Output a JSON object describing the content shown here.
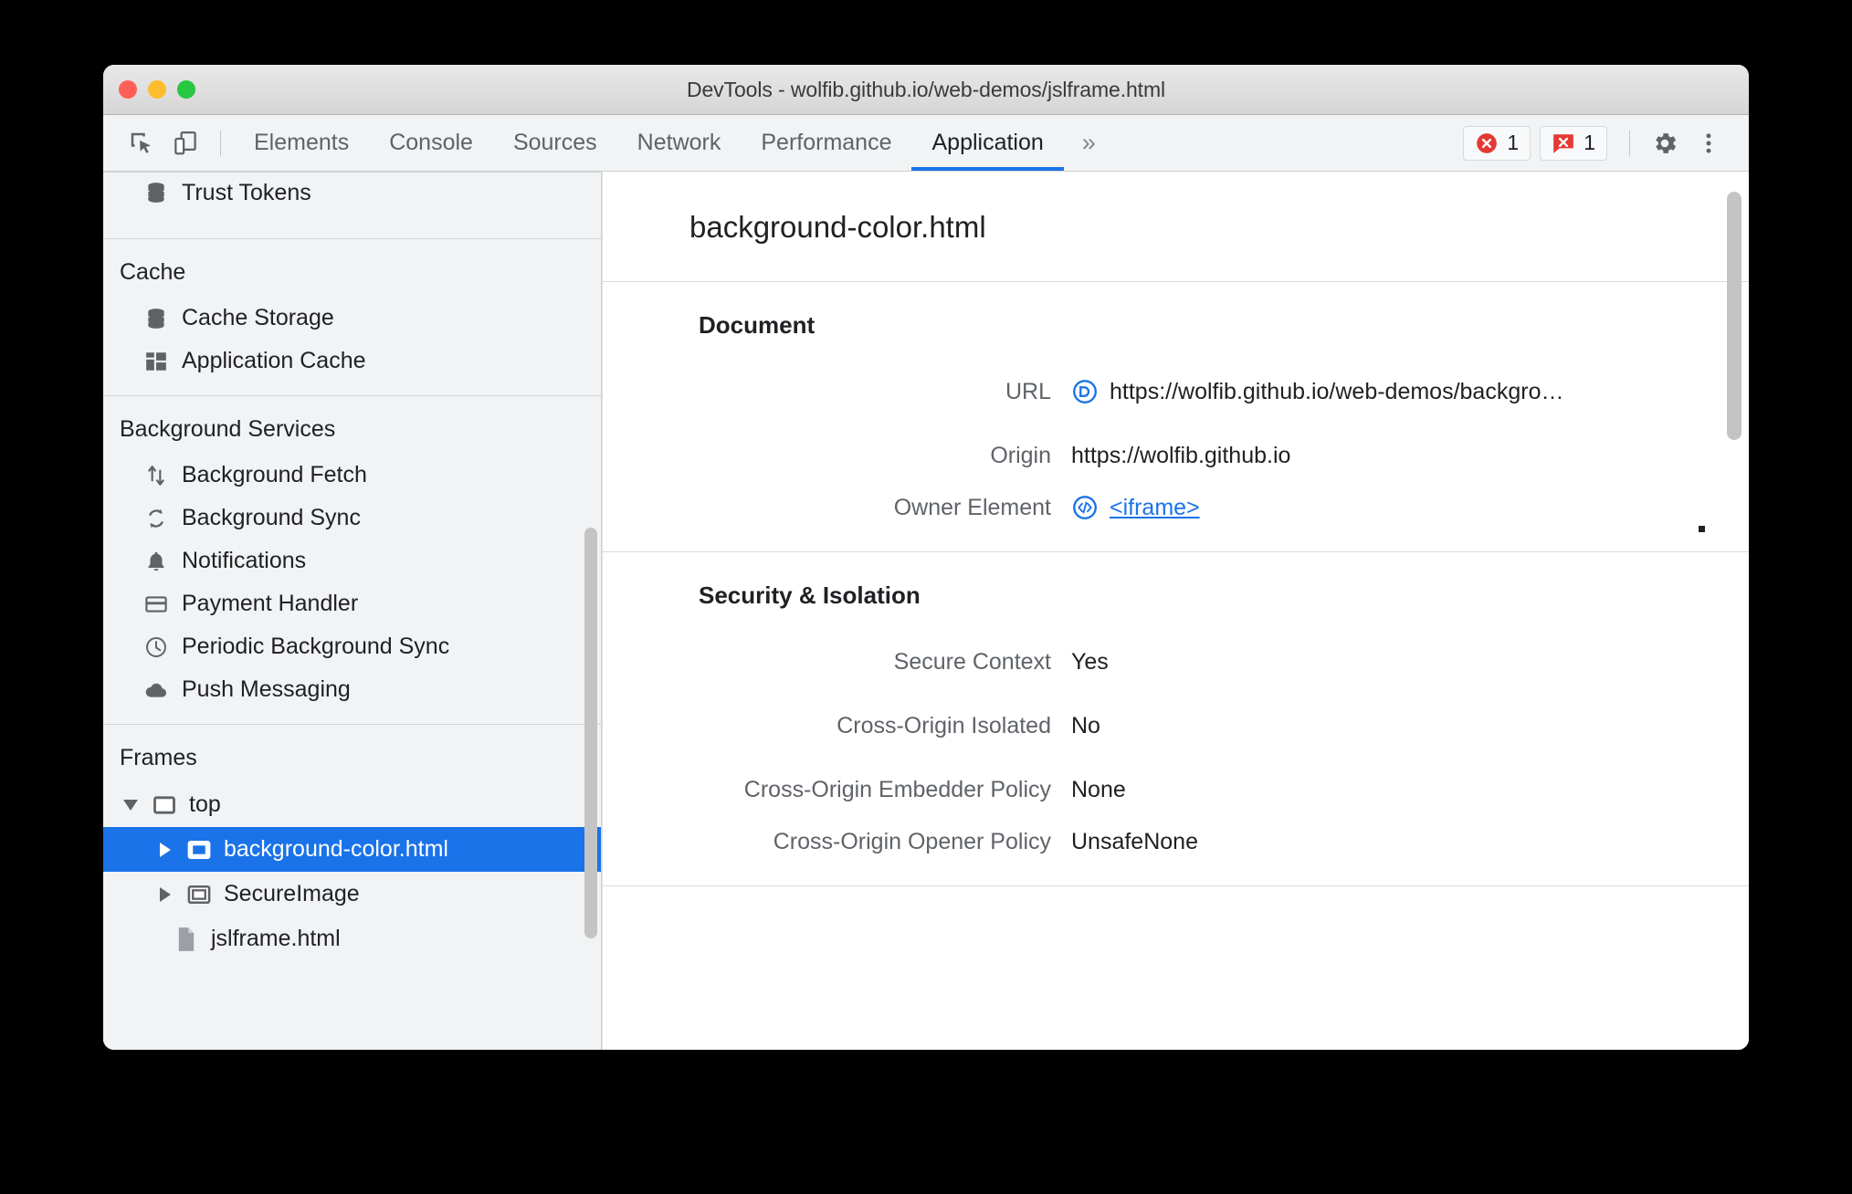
{
  "window": {
    "title": "DevTools - wolfib.github.io/web-demos/jslframe.html",
    "traffic_lights": [
      "close",
      "minimize",
      "maximize"
    ]
  },
  "toolbar": {
    "inspect_icon": "inspect-element-icon",
    "device_icon": "device-toolbar-icon",
    "tabs": [
      {
        "label": "Elements",
        "active": false
      },
      {
        "label": "Console",
        "active": false
      },
      {
        "label": "Sources",
        "active": false
      },
      {
        "label": "Network",
        "active": false
      },
      {
        "label": "Performance",
        "active": false
      },
      {
        "label": "Application",
        "active": true
      }
    ],
    "more_tabs_label": "»",
    "badges": [
      {
        "icon": "error-circle-icon",
        "count": "1"
      },
      {
        "icon": "console-error-icon",
        "count": "1"
      }
    ],
    "settings_icon": "gear-icon",
    "menu_icon": "kebab-menu-icon",
    "accent_color": "#1a73e8"
  },
  "sidebar": {
    "clipped_top_item": {
      "label": "Trust Tokens",
      "icon": "database-icon"
    },
    "sections": [
      {
        "title": "Cache",
        "items": [
          {
            "label": "Cache Storage",
            "icon": "database-icon"
          },
          {
            "label": "Application Cache",
            "icon": "grid-icon"
          }
        ]
      },
      {
        "title": "Background Services",
        "items": [
          {
            "label": "Background Fetch",
            "icon": "up-down-arrows-icon"
          },
          {
            "label": "Background Sync",
            "icon": "sync-icon"
          },
          {
            "label": "Notifications",
            "icon": "bell-icon"
          },
          {
            "label": "Payment Handler",
            "icon": "credit-card-icon"
          },
          {
            "label": "Periodic Background Sync",
            "icon": "clock-icon"
          },
          {
            "label": "Push Messaging",
            "icon": "cloud-icon"
          }
        ]
      }
    ],
    "frames": {
      "title": "Frames",
      "tree": [
        {
          "label": "top",
          "icon": "frame-icon",
          "twisty": "down",
          "depth": 1,
          "selected": false
        },
        {
          "label": "background-color.html",
          "icon": "iframe-icon",
          "twisty": "right",
          "depth": 2,
          "selected": true
        },
        {
          "label": "SecureImage",
          "icon": "iframe-icon",
          "twisty": "right",
          "depth": 2,
          "selected": false
        },
        {
          "label": "jslframe.html",
          "icon": "document-icon",
          "twisty": "none",
          "depth": 3,
          "selected": false
        }
      ]
    },
    "selection_color": "#1a73e8"
  },
  "main": {
    "page_title": "background-color.html",
    "groups": [
      {
        "title": "Document",
        "rows": [
          {
            "label": "URL",
            "value": "https://wolfib.github.io/web-demos/backgro…",
            "icon": "link-badge-icon",
            "link": false
          },
          {
            "label": "Origin",
            "value": "https://wolfib.github.io",
            "icon": "",
            "link": false
          },
          {
            "label": "Owner Element",
            "value": "<iframe>",
            "icon": "code-badge-icon",
            "link": true
          }
        ]
      },
      {
        "title": "Security & Isolation",
        "rows": [
          {
            "label": "Secure Context",
            "value": "Yes",
            "icon": "",
            "link": false
          },
          {
            "label": "Cross-Origin Isolated",
            "value": "No",
            "icon": "",
            "link": false
          },
          {
            "label": "Cross-Origin Embedder Policy",
            "value": "None",
            "icon": "",
            "link": false
          },
          {
            "label": "Cross-Origin Opener Policy",
            "value": "UnsafeNone",
            "icon": "",
            "link": false
          }
        ]
      }
    ]
  }
}
